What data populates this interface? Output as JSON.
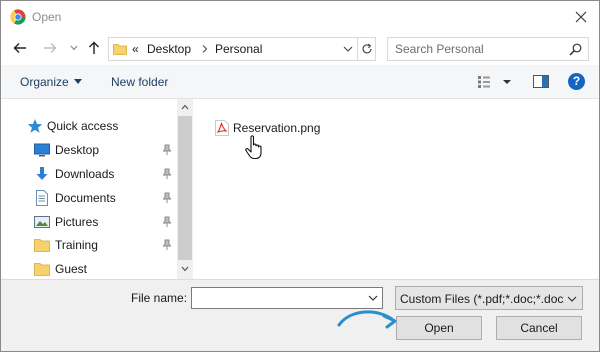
{
  "window": {
    "title": "Open",
    "app_icon": "chrome-icon",
    "close_icon": "close-icon"
  },
  "nav": {
    "back_icon": "back-arrow-icon",
    "forward_icon": "forward-arrow-icon",
    "recent_icon": "chevron-down-icon",
    "up_icon": "up-arrow-icon",
    "breadcrumb": {
      "overflow": "«",
      "items": [
        "Desktop",
        "Personal"
      ]
    },
    "refresh_icon": "refresh-icon"
  },
  "search": {
    "placeholder": "Search Personal",
    "icon": "search-icon"
  },
  "toolbar": {
    "organize_label": "Organize",
    "new_folder_label": "New folder",
    "view_icon": "view-options-icon",
    "preview_icon": "preview-pane-icon",
    "help_label": "?"
  },
  "sidebar": {
    "items": [
      {
        "label": "Quick access",
        "icon": "star-icon",
        "pinned": false
      },
      {
        "label": "Desktop",
        "icon": "desktop-icon",
        "pinned": true
      },
      {
        "label": "Downloads",
        "icon": "download-icon",
        "pinned": true
      },
      {
        "label": "Documents",
        "icon": "documents-icon",
        "pinned": true
      },
      {
        "label": "Pictures",
        "icon": "pictures-icon",
        "pinned": true
      },
      {
        "label": "Training",
        "icon": "folder-icon",
        "pinned": true
      },
      {
        "label": "Guest",
        "icon": "folder-icon",
        "pinned": false
      }
    ]
  },
  "files": [
    {
      "name": "Reservation.png",
      "icon": "pdf-icon"
    }
  ],
  "footer": {
    "file_name_label": "File name:",
    "file_name_value": "",
    "file_type_selected": "Custom Files (*.pdf;*.doc;*.docx)",
    "open_label": "Open",
    "cancel_label": "Cancel"
  },
  "colors": {
    "accent": "#1565c0",
    "link_text": "#1f3d66",
    "pdf_red": "#d32f2f",
    "folder_yellow": "#f5d26b",
    "annotation_arrow": "#2a8fd0"
  }
}
